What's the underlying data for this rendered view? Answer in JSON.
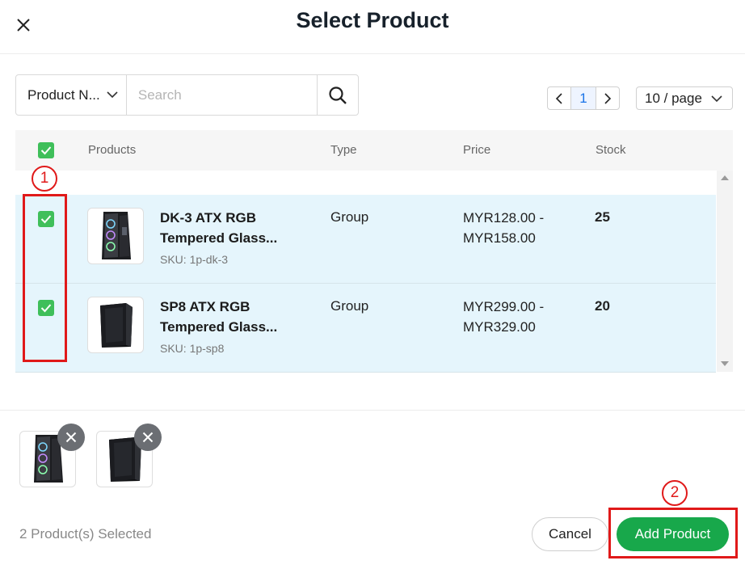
{
  "modal": {
    "title": "Select Product"
  },
  "filter": {
    "field_label": "Product N...",
    "search_placeholder": "Search",
    "search_value": ""
  },
  "pagination": {
    "current_page": "1",
    "page_size_label": "10 / page"
  },
  "table": {
    "headers": {
      "products": "Products",
      "type": "Type",
      "price": "Price",
      "stock": "Stock"
    },
    "rows": [
      {
        "name": "DK-3 ATX RGB Tempered Glass...",
        "sku": "SKU: 1p-dk-3",
        "type": "Group",
        "price": "MYR128.00 - MYR158.00",
        "stock": "25",
        "checked": true
      },
      {
        "name": "SP8 ATX RGB Tempered Glass...",
        "sku": "SKU: 1p-sp8",
        "type": "Group",
        "price": "MYR299.00 - MYR329.00",
        "stock": "20",
        "checked": true
      }
    ]
  },
  "annotations": {
    "step1": "1",
    "step2": "2"
  },
  "footer": {
    "selected_count": "2 Product(s) Selected",
    "cancel_label": "Cancel",
    "add_label": "Add Product"
  },
  "colors": {
    "accent_green": "#18a84b",
    "checkbox_green": "#3fbf5a",
    "row_highlight": "#e5f5fc",
    "annotation_red": "#e01919",
    "page_active": "#1a73e8"
  },
  "icons": {
    "close": "close-icon",
    "search": "search-icon",
    "chevron_down": "chevron-down-icon",
    "prev": "chevron-left-icon",
    "next": "chevron-right-icon",
    "check": "check-icon",
    "remove": "remove-icon"
  }
}
